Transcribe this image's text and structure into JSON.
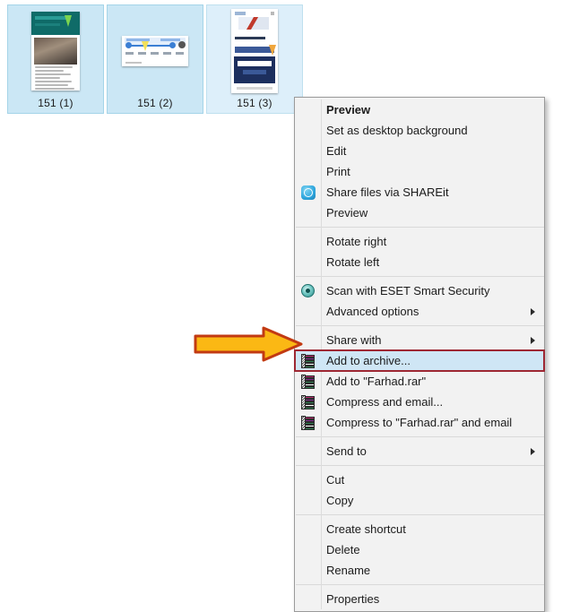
{
  "explorer": {
    "thumbnails": [
      {
        "label": "151 (1)",
        "selected": true,
        "variant": "chat-screenshot"
      },
      {
        "label": "151 (2)",
        "selected": true,
        "variant": "toolbar-screenshot"
      },
      {
        "label": "151 (3)",
        "selected": true,
        "variant": "login-screenshot"
      }
    ]
  },
  "context_menu": {
    "groups": [
      {
        "items": [
          {
            "label": "Preview",
            "bold": true,
            "icon": "none",
            "submenu": false
          },
          {
            "label": "Set as desktop background",
            "bold": false,
            "icon": "none",
            "submenu": false
          },
          {
            "label": "Edit",
            "bold": false,
            "icon": "none",
            "submenu": false
          },
          {
            "label": "Print",
            "bold": false,
            "icon": "none",
            "submenu": false
          },
          {
            "label": "Share files via SHAREit",
            "bold": false,
            "icon": "shareit-icon",
            "submenu": false
          },
          {
            "label": "Preview",
            "bold": false,
            "icon": "none",
            "submenu": false
          }
        ]
      },
      {
        "items": [
          {
            "label": "Rotate right",
            "bold": false,
            "icon": "none",
            "submenu": false
          },
          {
            "label": "Rotate left",
            "bold": false,
            "icon": "none",
            "submenu": false
          }
        ]
      },
      {
        "items": [
          {
            "label": "Scan with ESET Smart Security",
            "bold": false,
            "icon": "eset-icon",
            "submenu": false
          },
          {
            "label": "Advanced options",
            "bold": false,
            "icon": "none",
            "submenu": true
          }
        ]
      },
      {
        "items": [
          {
            "label": "Share with",
            "bold": false,
            "icon": "none",
            "submenu": true
          },
          {
            "label": "Add to archive...",
            "bold": false,
            "icon": "winrar-icon",
            "submenu": false,
            "highlighted": true
          },
          {
            "label": "Add to \"Farhad.rar\"",
            "bold": false,
            "icon": "winrar-icon",
            "submenu": false
          },
          {
            "label": "Compress and email...",
            "bold": false,
            "icon": "winrar-icon",
            "submenu": false
          },
          {
            "label": "Compress to \"Farhad.rar\" and email",
            "bold": false,
            "icon": "winrar-icon",
            "submenu": false
          }
        ]
      },
      {
        "items": [
          {
            "label": "Send to",
            "bold": false,
            "icon": "none",
            "submenu": true
          }
        ]
      },
      {
        "items": [
          {
            "label": "Cut",
            "bold": false,
            "icon": "none",
            "submenu": false
          },
          {
            "label": "Copy",
            "bold": false,
            "icon": "none",
            "submenu": false
          }
        ]
      },
      {
        "items": [
          {
            "label": "Create shortcut",
            "bold": false,
            "icon": "none",
            "submenu": false
          },
          {
            "label": "Delete",
            "bold": false,
            "icon": "none",
            "submenu": false
          },
          {
            "label": "Rename",
            "bold": false,
            "icon": "none",
            "submenu": false
          }
        ]
      },
      {
        "items": [
          {
            "label": "Properties",
            "bold": false,
            "icon": "none",
            "submenu": false
          }
        ]
      }
    ]
  },
  "annotation": {
    "arrow_fill": "#FBB814",
    "arrow_stroke": "#C23A12",
    "highlight_border": "#9E2833",
    "highlight_fill": "#CFE6F5",
    "points_at": "Add to archive..."
  },
  "colors": {
    "menu_background": "#F2F2F2",
    "menu_border": "#9A9A9A",
    "selection_blue": "#CBE7F5",
    "page_background": "#FFFFFF"
  }
}
